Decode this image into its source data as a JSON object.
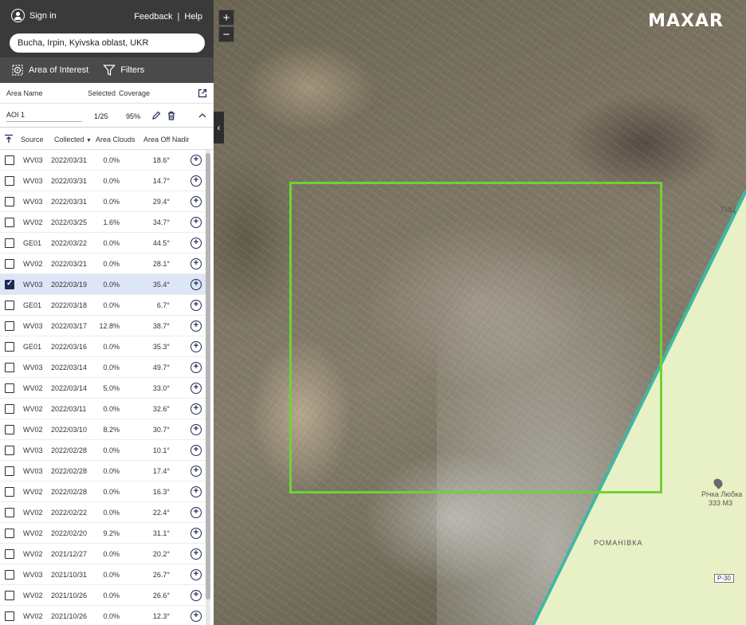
{
  "topbar": {
    "signin_label": "Sign in",
    "feedback_label": "Feedback",
    "separator": "|",
    "help_label": "Help"
  },
  "search": {
    "value": "Bucha, Irpin, Kyivska oblast, UKR"
  },
  "toolbar": {
    "aoi_label": "Area of Interest",
    "filters_label": "Filters"
  },
  "aoi_table": {
    "headers": {
      "area_name": "Area Name",
      "selected": "Selected",
      "coverage": "Coverage"
    },
    "row": {
      "name": "AOI 1",
      "selected": "1/25",
      "coverage": "95%"
    }
  },
  "list": {
    "headers": {
      "source": "Source",
      "collected": "Collected",
      "clouds": "Area Clouds",
      "nadir": "Area Off Nadir"
    },
    "sort_indicator": "▼",
    "rows": [
      {
        "source": "WV03",
        "date": "2022/03/31",
        "clouds": "0.0%",
        "nadir": "18.6°",
        "checked": false
      },
      {
        "source": "WV03",
        "date": "2022/03/31",
        "clouds": "0.0%",
        "nadir": "14.7°",
        "checked": false
      },
      {
        "source": "WV03",
        "date": "2022/03/31",
        "clouds": "0.0%",
        "nadir": "29.4°",
        "checked": false
      },
      {
        "source": "WV02",
        "date": "2022/03/25",
        "clouds": "1.6%",
        "nadir": "34.7°",
        "checked": false
      },
      {
        "source": "GE01",
        "date": "2022/03/22",
        "clouds": "0.0%",
        "nadir": "44.5°",
        "checked": false
      },
      {
        "source": "WV02",
        "date": "2022/03/21",
        "clouds": "0.0%",
        "nadir": "28.1°",
        "checked": false
      },
      {
        "source": "WV03",
        "date": "2022/03/19",
        "clouds": "0.0%",
        "nadir": "35.4°",
        "checked": true
      },
      {
        "source": "GE01",
        "date": "2022/03/18",
        "clouds": "0.0%",
        "nadir": "6.7°",
        "checked": false
      },
      {
        "source": "WV03",
        "date": "2022/03/17",
        "clouds": "12.8%",
        "nadir": "38.7°",
        "checked": false
      },
      {
        "source": "GE01",
        "date": "2022/03/16",
        "clouds": "0.0%",
        "nadir": "35.3°",
        "checked": false
      },
      {
        "source": "WV03",
        "date": "2022/03/14",
        "clouds": "0.0%",
        "nadir": "49.7°",
        "checked": false
      },
      {
        "source": "WV02",
        "date": "2022/03/14",
        "clouds": "5.0%",
        "nadir": "33.0°",
        "checked": false
      },
      {
        "source": "WV02",
        "date": "2022/03/11",
        "clouds": "0.0%",
        "nadir": "32.6°",
        "checked": false
      },
      {
        "source": "WV02",
        "date": "2022/03/10",
        "clouds": "8.2%",
        "nadir": "30.7°",
        "checked": false
      },
      {
        "source": "WV03",
        "date": "2022/02/28",
        "clouds": "0.0%",
        "nadir": "10.1°",
        "checked": false
      },
      {
        "source": "WV03",
        "date": "2022/02/28",
        "clouds": "0.0%",
        "nadir": "17.4°",
        "checked": false
      },
      {
        "source": "WV02",
        "date": "2022/02/28",
        "clouds": "0.0%",
        "nadir": "16.3°",
        "checked": false
      },
      {
        "source": "WV02",
        "date": "2022/02/22",
        "clouds": "0.0%",
        "nadir": "22.4°",
        "checked": false
      },
      {
        "source": "WV02",
        "date": "2022/02/20",
        "clouds": "9.2%",
        "nadir": "31.1°",
        "checked": false
      },
      {
        "source": "WV02",
        "date": "2021/12/27",
        "clouds": "0.0%",
        "nadir": "20.2°",
        "checked": false
      },
      {
        "source": "WV03",
        "date": "2021/10/31",
        "clouds": "0.0%",
        "nadir": "26.7°",
        "checked": false
      },
      {
        "source": "WV02",
        "date": "2021/10/26",
        "clouds": "0.0%",
        "nadir": "26.6°",
        "checked": false
      },
      {
        "source": "WV02",
        "date": "2021/10/26",
        "clouds": "0.0%",
        "nadir": "12.3°",
        "checked": false
      }
    ]
  },
  "map": {
    "logo": "MAXAR",
    "zoom_in": "+",
    "zoom_out": "−",
    "collapse_glyph": "‹",
    "label_town": "РОМАНІВКА",
    "label_river": "Річка Любка",
    "label_elev": "333 М3",
    "label_road": "P-30",
    "label_edge": "ТИЦ",
    "aoi_color": "#6fd235",
    "basemap_color": "#e8f1c5",
    "edge_color": "#3fb7a3"
  }
}
